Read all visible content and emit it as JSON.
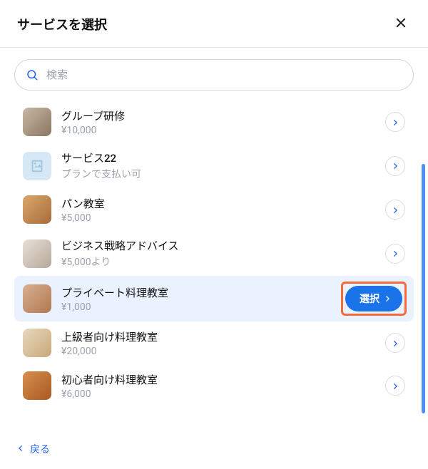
{
  "header": {
    "title": "サービスを選択"
  },
  "search": {
    "placeholder": "検索"
  },
  "select_button_label": "選択",
  "services": [
    {
      "title": "グループ研修",
      "sub": "¥10,000",
      "thumb": "photo1",
      "selected": false
    },
    {
      "title": "サービス22",
      "sub": "プランで支払い可",
      "thumb": "placeholder",
      "selected": false
    },
    {
      "title": "パン教室",
      "sub": "¥5,000",
      "thumb": "photo2",
      "selected": false
    },
    {
      "title": "ビジネス戦略アドバイス",
      "sub": "¥5,000より",
      "thumb": "photo3",
      "selected": false
    },
    {
      "title": "プライベート料理教室",
      "sub": "¥1,000",
      "thumb": "photo4",
      "selected": true
    },
    {
      "title": "上級者向け料理教室",
      "sub": "¥20,000",
      "thumb": "photo5",
      "selected": false
    },
    {
      "title": "初心者向け料理教室",
      "sub": "¥6,000",
      "thumb": "photo6",
      "selected": false
    }
  ],
  "footer": {
    "back_label": "戻る"
  }
}
